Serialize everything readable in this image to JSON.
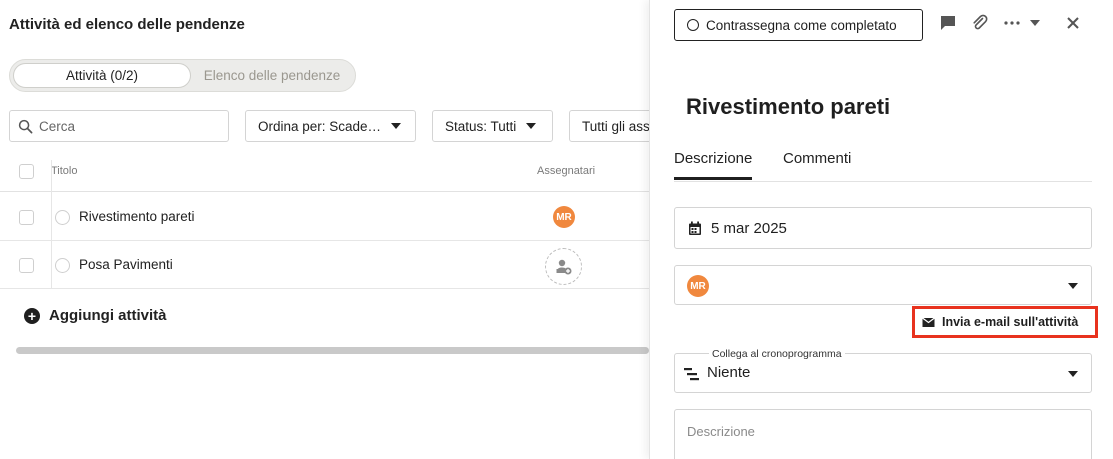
{
  "left": {
    "title": "Attività ed elenco delle pendenze",
    "segments": [
      {
        "label": "Attività (0/2)",
        "active": true
      },
      {
        "label": "Elenco delle pendenze",
        "active": false
      }
    ],
    "search": {
      "placeholder": "Cerca",
      "value": ""
    },
    "filters": {
      "sort": "Ordina per: Scade…",
      "status": "Status: Tutti",
      "assignees": "Tutti gli assegnatari"
    },
    "table": {
      "headers": {
        "title": "Titolo",
        "assignees": "Assegnatari"
      },
      "rows": [
        {
          "name": "Rivestimento pareti",
          "assignee": "MR"
        },
        {
          "name": "Posa Pavimenti",
          "assignee": ""
        }
      ]
    },
    "add_task": "Aggiungi attività"
  },
  "detail": {
    "complete_button": "Contrassegna come completato",
    "title": "Rivestimento pareti",
    "tabs": [
      {
        "label": "Descrizione",
        "active": true
      },
      {
        "label": "Commenti",
        "active": false
      }
    ],
    "date": "5 mar 2025",
    "assignee_initials": "MR",
    "email_button": "Invia e-mail sull'attività",
    "link": {
      "legend": "Collega al cronoprogramma",
      "value": "Niente"
    },
    "description_placeholder": "Descrizione"
  },
  "colors": {
    "avatar": "#f0883e",
    "highlight": "#e8321e",
    "text": "#1f1f1f"
  }
}
